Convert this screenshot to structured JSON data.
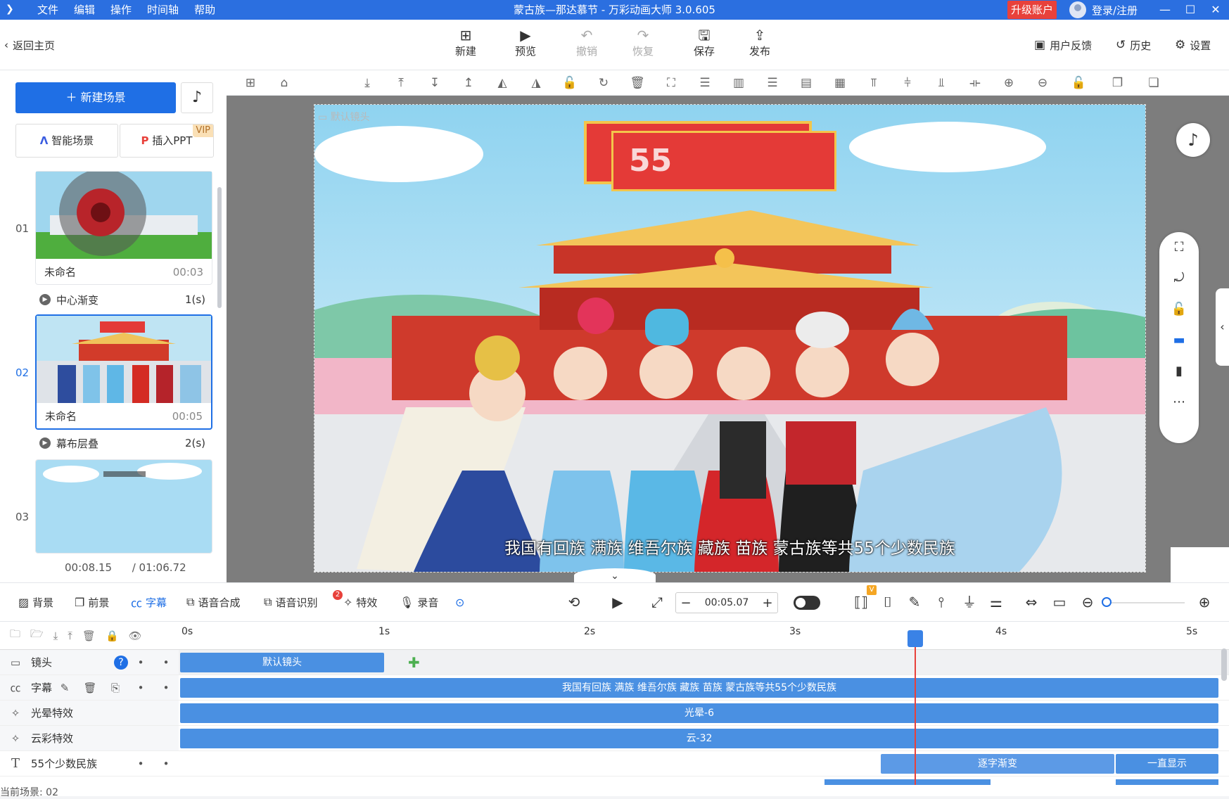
{
  "titlebar": {
    "menu": [
      "文件",
      "编辑",
      "操作",
      "时间轴",
      "帮助"
    ],
    "title": "蒙古族—那达慕节 - 万彩动画大师 3.0.605",
    "upgrade": "升级账户",
    "login": "登录/注册"
  },
  "toolbar": {
    "back": "返回主页",
    "buttons": [
      {
        "label": "新建",
        "icon": "plus-square-icon"
      },
      {
        "label": "预览",
        "icon": "play-icon"
      },
      {
        "label": "撤销",
        "icon": "undo-icon"
      },
      {
        "label": "恢复",
        "icon": "redo-icon"
      },
      {
        "label": "保存",
        "icon": "save-icon"
      },
      {
        "label": "发布",
        "icon": "publish-icon"
      }
    ],
    "right": [
      "用户反馈",
      "历史",
      "设置"
    ]
  },
  "left_panel": {
    "new_scene": "新建场景",
    "smart_scene": "智能场景",
    "insert_ppt": "插入PPT",
    "vip": "VIP",
    "scenes": [
      {
        "num": "01",
        "name": "未命名",
        "time": "00:03",
        "transition": "中心渐变",
        "trans_dur": "1(s)"
      },
      {
        "num": "02",
        "name": "未命名",
        "time": "00:05",
        "transition": "幕布层叠",
        "trans_dur": "2(s)"
      },
      {
        "num": "03",
        "name": "",
        "time": ""
      }
    ],
    "current_time": "00:08.15",
    "total_time": "/ 01:06.72"
  },
  "stage": {
    "camera_label": "默认镜头",
    "banner_text": "55",
    "subtitle": "我国有回族 满族 维吾尔族 藏族 苗族 蒙古族等共55个少数民族"
  },
  "effects_bar": {
    "items": [
      "背景",
      "前景",
      "字幕",
      "语音合成",
      "语音识别",
      "特效",
      "录音"
    ],
    "badge": "2",
    "time_value": "00:05.07",
    "v_badge": "V"
  },
  "timeline": {
    "ruler": [
      "0s",
      "1s",
      "2s",
      "3s",
      "4s",
      "5s"
    ],
    "tracks": [
      {
        "name": "镜头",
        "icon": "camera-icon"
      },
      {
        "name": "字幕",
        "icon": "cc-icon"
      },
      {
        "name": "光晕特效",
        "icon": "effect-icon"
      },
      {
        "name": "云彩特效",
        "icon": "effect-icon"
      },
      {
        "name": "55个少数民族",
        "icon": "text-icon"
      }
    ],
    "clips": {
      "camera": "默认镜头",
      "subtitle": "我国有回族 满族 维吾尔族 藏族 苗族 蒙古族等共55个少数民族",
      "glow": "光晕-6",
      "cloud": "云-32",
      "text_in": "逐字渐变",
      "text_stay": "一直显示"
    },
    "help": "?"
  },
  "footer": {
    "current_scene": "当前场景: 02"
  }
}
